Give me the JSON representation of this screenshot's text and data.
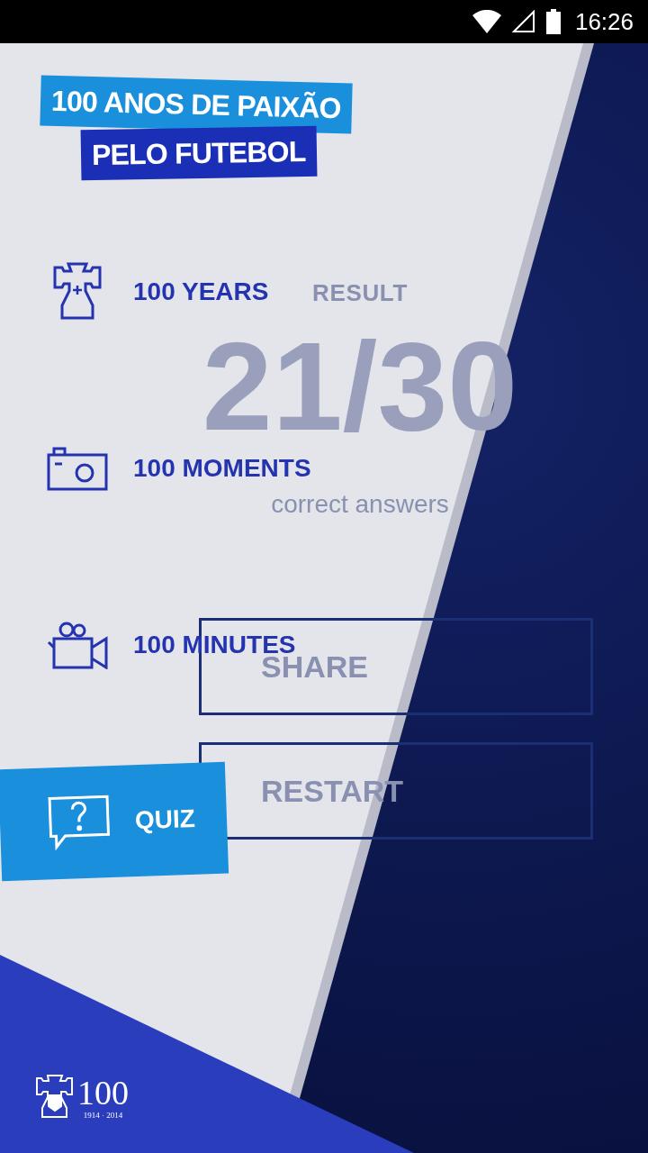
{
  "status_bar": {
    "time": "16:26"
  },
  "result_screen": {
    "title": "RESULT",
    "score": "21/30",
    "caption": "correct answers",
    "buttons": [
      "SHARE",
      "RESTART"
    ]
  },
  "drawer": {
    "header": [
      "100 ANOS DE PAIXÃO",
      "PELO FUTEBOL"
    ],
    "items": [
      {
        "kind": "cross",
        "label": "100 YEARS",
        "selected": false
      },
      {
        "kind": "camera",
        "label": "100 MOMENTS",
        "selected": false
      },
      {
        "kind": "video",
        "label": "100 MINUTES",
        "selected": false
      },
      {
        "kind": "quiz",
        "label": "QUIZ",
        "selected": true
      }
    ],
    "logo": {
      "number": "100",
      "years": "1914 · 2014"
    }
  }
}
